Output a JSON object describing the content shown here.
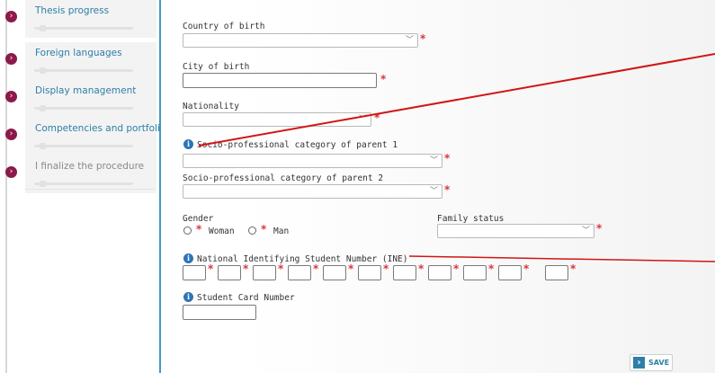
{
  "sidebar": {
    "items": [
      {
        "label": "Thesis progress",
        "enabled": true
      },
      {
        "label": "Foreign languages",
        "enabled": true
      },
      {
        "label": "Display management",
        "enabled": true
      },
      {
        "label": "Competencies and portfolio",
        "enabled": true
      },
      {
        "label": "I finalize the procedure",
        "enabled": false
      }
    ]
  },
  "form": {
    "country_of_birth": {
      "label": "Country of birth",
      "value": ""
    },
    "city_of_birth": {
      "label": "City of birth",
      "value": ""
    },
    "nationality": {
      "label": "Nationality",
      "value": ""
    },
    "parent1_category": {
      "label": "Socio-professional category of parent 1",
      "value": ""
    },
    "parent2_category": {
      "label": "Socio-professional category of parent 2",
      "value": ""
    },
    "gender": {
      "label": "Gender",
      "options": [
        "Woman",
        "Man"
      ],
      "selected": null
    },
    "family_status": {
      "label": "Family status",
      "value": ""
    },
    "ine": {
      "label": "National Identifying Student Number (INE)",
      "box_count": 11
    },
    "student_card": {
      "label": "Student Card Number",
      "value": ""
    },
    "required_mark": "*"
  },
  "actions": {
    "save_label": "SAVE"
  },
  "colors": {
    "accent": "#2d7fa7",
    "bullet": "#8b1a4a",
    "required": "#d9363e",
    "annotation_line": "#d11515",
    "info_icon": "#2b74b8"
  },
  "icons": {
    "nav_bullet": "chevron-right-icon",
    "select_arrow": "chevron-down-icon",
    "info": "info-icon",
    "save": "arrow-right-icon"
  }
}
